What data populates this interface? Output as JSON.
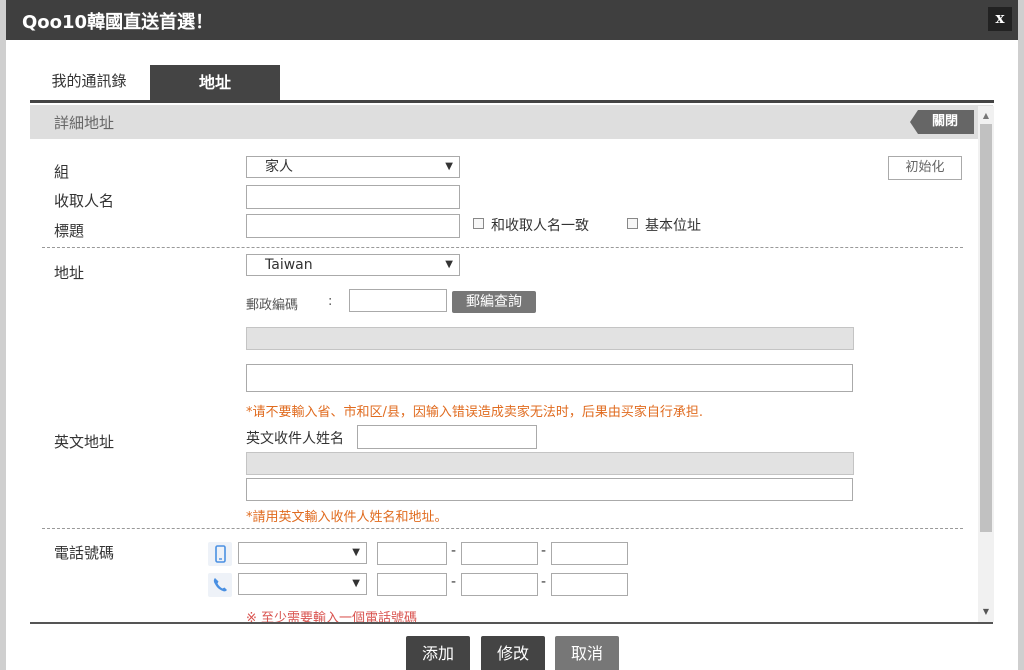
{
  "window": {
    "title": "Qoo10韓國直送首選！",
    "close_label": "x"
  },
  "tabs": [
    {
      "label": "我的通訊錄",
      "active": false
    },
    {
      "label": "地址",
      "active": true
    }
  ],
  "section": {
    "title": "詳細地址",
    "close_label": "關閉"
  },
  "form": {
    "group_label": "組",
    "group_value": "家人",
    "reset_label": "初始化",
    "recipient_label": "收取人名",
    "recipient_value": "",
    "title_label": "標題",
    "title_value": "",
    "same_as_recipient_label": "和收取人名一致",
    "default_address_label": "基本位址",
    "address_label": "地址",
    "country_value": "Taiwan",
    "postal_label": "郵政編碼",
    "postal_colon": ":",
    "postal_value": "",
    "postal_search_label": "郵編查詢",
    "address_note": "*请不要輸入省、市和区/县，因输入错误造成卖家无法时，后果由买家自行承担.",
    "english_address_label": "英文地址",
    "english_name_label": "英文收件人姓名",
    "english_note": "*請用英文輸入收件人姓名和地址。",
    "phone_label": "電話號碼",
    "phone_hyphen": "-",
    "phone_note": "※ 至少需要輸入一個電話號碼"
  },
  "actions": {
    "add_label": "添加",
    "edit_label": "修改",
    "cancel_label": "取消"
  },
  "colors": {
    "title_bar": "#3f3f3f",
    "active_tab": "#444444",
    "note_orange": "#e06b1f",
    "note_red": "#d9534f",
    "button_dark": "#444444",
    "button_gray": "#777777"
  }
}
